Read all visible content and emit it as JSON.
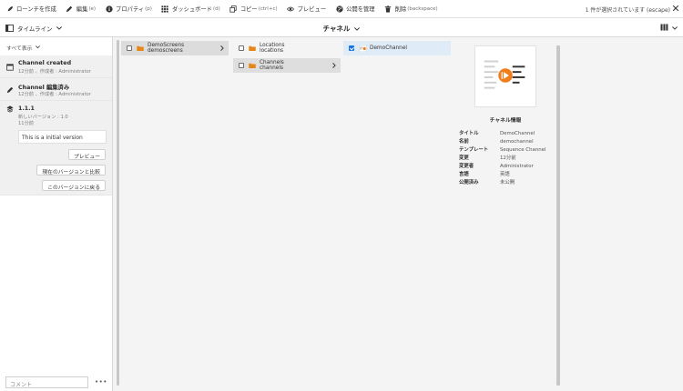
{
  "actions": [
    {
      "label": "ローンチを作成",
      "shortcut": "",
      "icon": "rocket-icon"
    },
    {
      "label": "編集",
      "shortcut": "(e)",
      "icon": "pencil-icon"
    },
    {
      "label": "プロパティ",
      "shortcut": "(p)",
      "icon": "info-icon"
    },
    {
      "label": "ダッシュボード",
      "shortcut": "(d)",
      "icon": "grid-icon"
    },
    {
      "label": "コピー",
      "shortcut": "(ctrl+c)",
      "icon": "copy-icon"
    },
    {
      "label": "プレビュー",
      "shortcut": "",
      "icon": "eye-icon"
    },
    {
      "label": "公開を管理",
      "shortcut": "",
      "icon": "globe-icon"
    },
    {
      "label": "削除",
      "shortcut": "(backspace)",
      "icon": "trash-icon"
    }
  ],
  "selection_info": "1 件が選択されています (escape)",
  "header": {
    "rail_label": "タイムライン",
    "title": "チャネル"
  },
  "rail": {
    "filter": "すべて表示",
    "entries": [
      {
        "title": "Channel created",
        "sub": "12分前 、作成者 : Administrator"
      },
      {
        "title": "Channel 編集済み",
        "sub": "12分前 、作成者 : Administrator"
      },
      {
        "title": "1.1.1",
        "sub": "新しいバージョン : 1.0",
        "sub2": "11分前",
        "comment": "This is a initial version"
      }
    ],
    "buttons": {
      "preview": "プレビュー",
      "compare": "現在のバージョンと比較",
      "revert": "このバージョンに戻る"
    },
    "comment_placeholder": "コメント",
    "more": "•••"
  },
  "columns": {
    "col1": [
      {
        "title": "DemoScreens",
        "name": "demoscreens"
      }
    ],
    "col2": [
      {
        "title": "Locations",
        "name": "locations"
      },
      {
        "title": "Channels",
        "name": "channels"
      }
    ],
    "col3": [
      {
        "title": "DemoChannel"
      }
    ]
  },
  "panel": {
    "heading": "チャネル情報",
    "rows": [
      {
        "k": "タイトル",
        "v": "DemoChannel"
      },
      {
        "k": "名前",
        "v": "demochannel"
      },
      {
        "k": "テンプレート",
        "v": "Sequence Channel"
      },
      {
        "k": "変更",
        "v": "12分前"
      },
      {
        "k": "変更者",
        "v": "Administrator"
      },
      {
        "k": "言語",
        "v": "英語"
      },
      {
        "k": "公開済み",
        "v": "未公開"
      }
    ]
  },
  "colors": {
    "accent": "#1473e6",
    "folder": "#e68619",
    "badge": "#f07e1b"
  }
}
